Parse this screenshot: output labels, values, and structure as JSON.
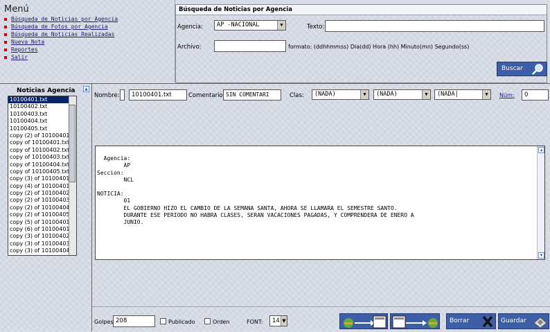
{
  "menu": {
    "title": "Menú",
    "items": [
      "Búsqueda de Noticias por Agencia",
      "Búsqueda de Fotos por Agencia",
      "Búsqueda de Noticias Realizadas",
      "Nueva Nota",
      "Reportes",
      "Salir"
    ]
  },
  "search": {
    "title": "Búsqueda de Noticias por Agencia",
    "agencia_label": "Agencia:",
    "agencia_value": "AP -NACIONAL",
    "texto_label": "Texto:",
    "texto_value": "",
    "archivo_label": "Archivo:",
    "archivo_value": "",
    "formato_hint": "formato: (ddhhmmss) Dia(dd) Hora (hh) Minuto(mn) Segundo(ss)",
    "buscar_label": "Buscar"
  },
  "list": {
    "title": "Noticias Agencia",
    "items": [
      "10100401.txt",
      "10100402.txt",
      "10100403.txt",
      "10100404.txt",
      "10100405.txt",
      "copy (2) of 10100401",
      "copy of 10100401.txt",
      "copy of 10100402.txt",
      "copy of 10100403.txt",
      "copy of 10100404.txt",
      "copy of 10100405.txt",
      "copy (3) of 10100401",
      "copy (4) of 10100401",
      "copy (2) of 10100402",
      "copy (2) of 10100403",
      "copy (2) of 10100404",
      "copy (2) of 10100405",
      "copy (5) of 10100401",
      "copy (6) of 10100401",
      "copy (3) of 10100402",
      "copy (3) of 10100403",
      "copy (3) of 10100404"
    ],
    "selected_index": 0
  },
  "form": {
    "nombre_label": "Nombre:",
    "nombre_value": "10100401.txt",
    "comentario_label": "Comentario:",
    "comentario_value": "SIN COMENTARI",
    "clas_label": "Clas:",
    "clas1": "(NADA)",
    "clas2": "(NADA)",
    "clas3": "(NADA|",
    "num_label": "Núm:",
    "num_value": "0"
  },
  "content": {
    "text": "Agencia:\n        AP\nSeccion:\n        NCL\n\nNOTICIA:\n        01\n        EL GOBIERNO HIZO EL CAMBIO DE LA SEMANA SANTA, AHORA SE LLAMARA EL SEMESTRE SANTO.\n        DURANTE ESE PERIODO NO HABRA CLASES, SERAN VACACIONES PAGADAS, Y COMPRENDERA DE ENERO A\n        JUNIO."
  },
  "bottom": {
    "golpes_label": "Golpes",
    "golpes_value": "208",
    "publicado_label": "Publicado",
    "orden_label": "Orden",
    "font_label": "FONT:",
    "font_value": "14",
    "borrar_label": "Borrar",
    "guardar_label": "Guardar"
  },
  "colors": {
    "accent": "#3d5fa8",
    "menu_bullet": "#c00000",
    "selection": "#0a246a"
  }
}
